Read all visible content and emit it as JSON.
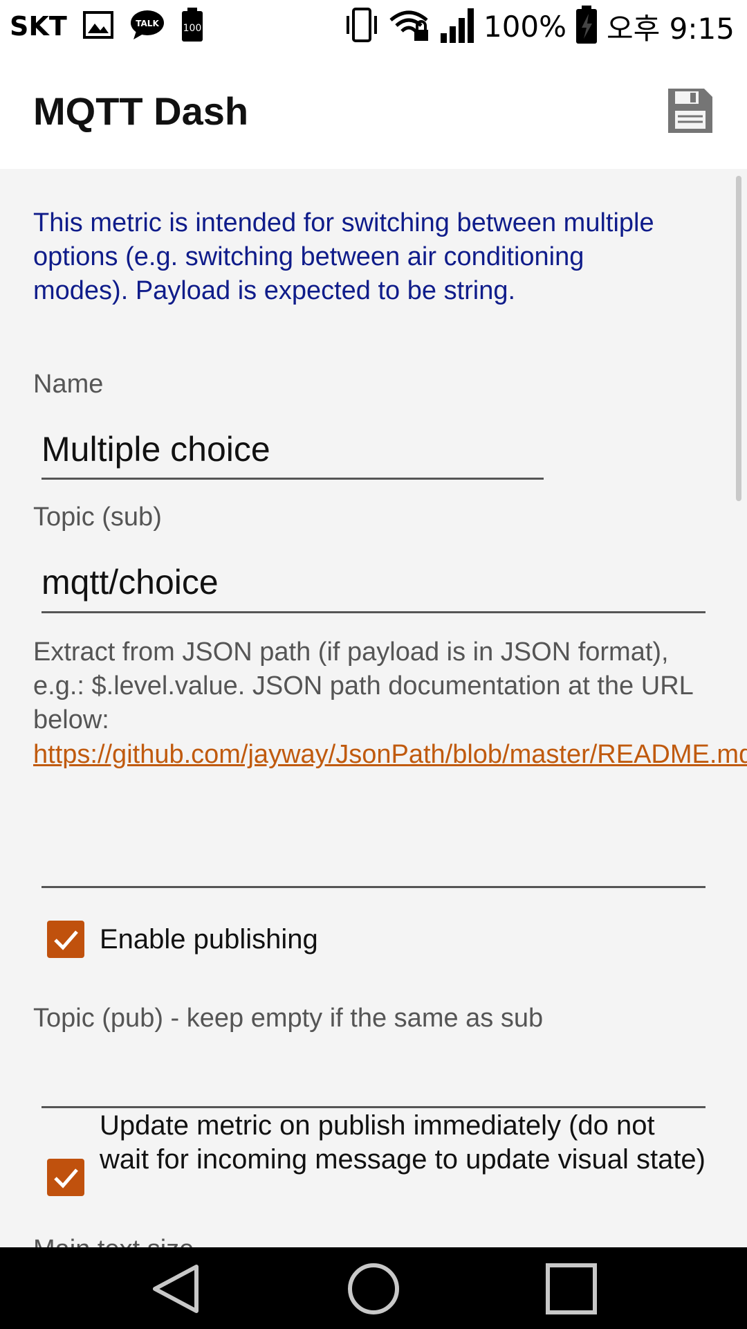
{
  "status_bar": {
    "carrier": "SKT",
    "battery_percent": "100%",
    "time": "오후 9:15",
    "left_icons": [
      "gallery-icon",
      "talk-icon",
      "battery-100-icon"
    ],
    "right_icons": [
      "vibrate-icon",
      "wifi-lock-icon",
      "signal-icon",
      "battery-charging-icon"
    ]
  },
  "app_bar": {
    "title": "MQTT Dash",
    "save_icon": "save-icon"
  },
  "form": {
    "info_text": "This metric is intended for switching between multiple options (e.g. switching between air conditioning modes). Payload is expected to be string.",
    "name_label": "Name",
    "name_value": "Multiple choice",
    "topic_sub_label": "Topic (sub)",
    "topic_sub_value": "mqtt/choice",
    "json_path_help": "Extract from JSON path (if payload is in JSON format), e.g.: $.level.value. JSON path documentation at the URL below:",
    "json_path_link": "https://github.com/jayway/JsonPath/blob/master/README.md",
    "json_path_value": "",
    "enable_publishing_label": "Enable publishing",
    "enable_publishing_checked": true,
    "topic_pub_label": "Topic (pub) - keep empty if the same as sub",
    "topic_pub_value": "",
    "update_metric_label": "Update metric on publish immediately (do not wait for incoming message to update visual state)",
    "update_metric_checked": true,
    "next_label_partial": "Main text size"
  },
  "nav_bar": {
    "back_icon": "back-triangle-icon",
    "home_icon": "home-circle-icon",
    "recents_icon": "recents-square-icon"
  },
  "colors": {
    "accent": "#c0510d",
    "info_text": "#0f1c8a",
    "link": "#c05a0e",
    "background": "#f4f4f4"
  }
}
